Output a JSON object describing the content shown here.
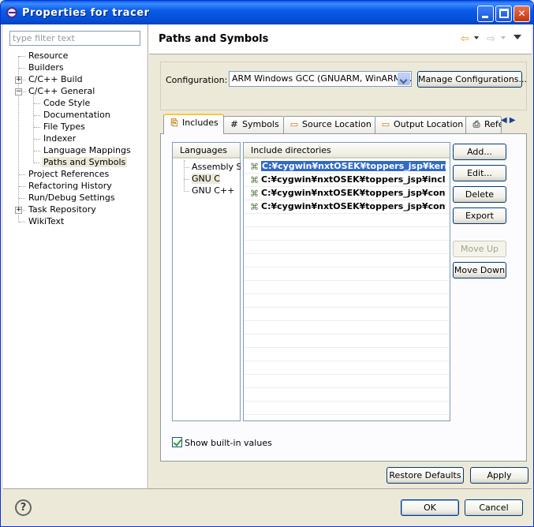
{
  "window": {
    "title": "Properties for tracer"
  },
  "filter": {
    "placeholder": "type filter text"
  },
  "tree": [
    {
      "label": "Resource",
      "depth": 0,
      "expander": ""
    },
    {
      "label": "Builders",
      "depth": 0,
      "expander": ""
    },
    {
      "label": "C/C++ Build",
      "depth": 0,
      "expander": "+"
    },
    {
      "label": "C/C++ General",
      "depth": 0,
      "expander": "-"
    },
    {
      "label": "Code Style",
      "depth": 1,
      "expander": ""
    },
    {
      "label": "Documentation",
      "depth": 1,
      "expander": ""
    },
    {
      "label": "File Types",
      "depth": 1,
      "expander": ""
    },
    {
      "label": "Indexer",
      "depth": 1,
      "expander": ""
    },
    {
      "label": "Language Mappings",
      "depth": 1,
      "expander": ""
    },
    {
      "label": "Paths and Symbols",
      "depth": 1,
      "expander": "",
      "selected": true
    },
    {
      "label": "Project References",
      "depth": 0,
      "expander": ""
    },
    {
      "label": "Refactoring History",
      "depth": 0,
      "expander": ""
    },
    {
      "label": "Run/Debug Settings",
      "depth": 0,
      "expander": ""
    },
    {
      "label": "Task Repository",
      "depth": 0,
      "expander": "+"
    },
    {
      "label": "WikiText",
      "depth": 0,
      "expander": ""
    }
  ],
  "page": {
    "title": "Paths and Symbols"
  },
  "config": {
    "label": "Configuration:",
    "selected": "ARM Windows GCC (GNUARM, WinARM, ...",
    "manage_label": "Manage Configurations..."
  },
  "tabs": [
    {
      "label": "Includes",
      "icon": "includes-icon",
      "active": true
    },
    {
      "label": "Symbols",
      "icon": "hash-icon"
    },
    {
      "label": "Source Location",
      "icon": "folder-icon"
    },
    {
      "label": "Output Location",
      "icon": "folder-icon"
    },
    {
      "label": "Refe",
      "icon": "references-icon"
    }
  ],
  "languages": {
    "header": "Languages",
    "items": [
      "Assembly Source",
      "GNU C",
      "GNU C++"
    ],
    "selected_index": 1
  },
  "includes": {
    "header": "Include directories",
    "rows": [
      "C:¥cygwin¥nxtOSEK¥toppers_jsp¥kernel",
      "C:¥cygwin¥nxtOSEK¥toppers_jsp¥include",
      "C:¥cygwin¥nxtOSEK¥toppers_jsp¥config",
      "C:¥cygwin¥nxtOSEK¥toppers_jsp¥config"
    ],
    "selected_index": 0
  },
  "side_buttons": {
    "add": "Add...",
    "edit": "Edit...",
    "delete": "Delete",
    "export": "Export",
    "move_up": "Move Up",
    "move_down": "Move Down"
  },
  "show_builtin": {
    "label": "Show built-in values",
    "checked": true
  },
  "footer_buttons": {
    "restore": "Restore Defaults",
    "apply": "Apply",
    "ok": "OK",
    "cancel": "Cancel"
  },
  "colors": {
    "titlebar": "#0a5ce8",
    "selection": "#316ac5",
    "dialog_bg": "#ece9d8"
  }
}
